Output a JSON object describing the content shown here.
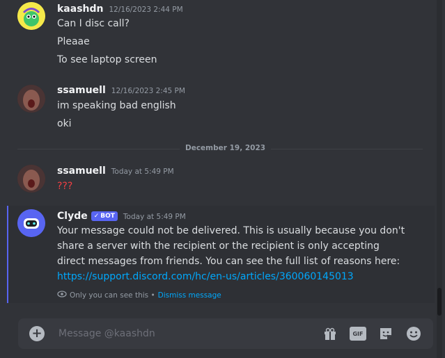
{
  "messages": [
    {
      "username": "kaashdn",
      "timestamp": "12/16/2023 2:44 PM",
      "lines": [
        "Can I disc call?",
        "Pleaae",
        "To see laptop screen"
      ]
    },
    {
      "username": "ssamuell",
      "timestamp": "12/16/2023 2:45 PM",
      "lines": [
        "im speaking bad english",
        "oki"
      ]
    },
    {
      "username": "ssamuell",
      "timestamp": "Today at 5:49 PM",
      "lines": [
        "???"
      ]
    }
  ],
  "divider": {
    "label": "December 19, 2023"
  },
  "clyde": {
    "username": "Clyde",
    "badge": "BOT",
    "timestamp": "Today at 5:49 PM",
    "text": "Your message could not be delivered. This is usually because you don't share a server with the recipient or the recipient is only accepting direct messages from friends. You can see the full list of reasons here:",
    "link": "https://support.discord.com/hc/en-us/articles/360060145013",
    "ephemeral_note": "Only you can see this •",
    "dismiss_label": "Dismiss message"
  },
  "composer": {
    "placeholder": "Message @kaashdn",
    "tools": [
      "gift-icon",
      "gif-icon",
      "sticker-icon",
      "emoji-icon"
    ]
  },
  "colors": {
    "background": "#313338",
    "accent": "#5865f2",
    "link": "#00a8fc",
    "danger": "#f23f43"
  }
}
